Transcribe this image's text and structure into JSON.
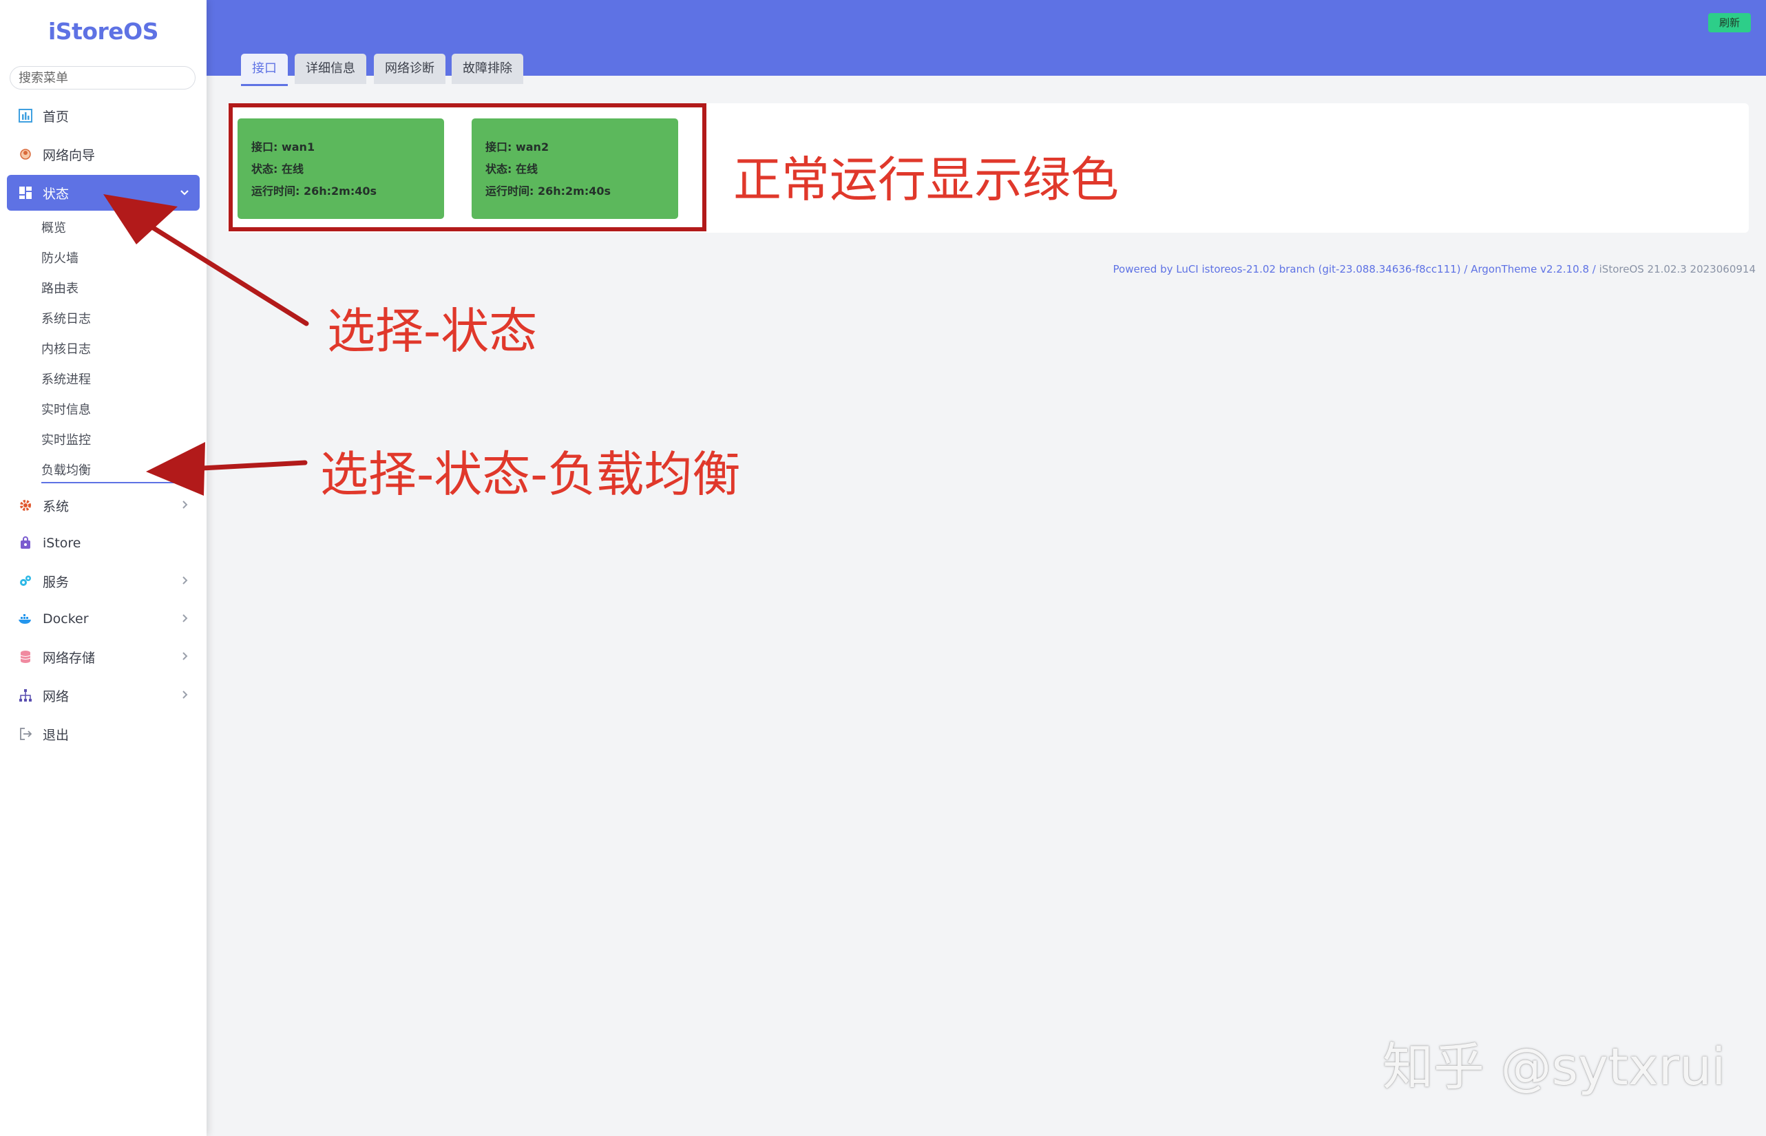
{
  "app": {
    "logo": "iStoreOS"
  },
  "sidebar": {
    "search_placeholder": "搜索菜单",
    "items": [
      {
        "label": "首页",
        "icon": "chart-bar-icon"
      },
      {
        "label": "网络向导",
        "icon": "globe-pin-icon"
      },
      {
        "label": "状态",
        "icon": "dashboard-grid-icon",
        "expanded": true
      },
      {
        "label": "系统",
        "icon": "gear-icon"
      },
      {
        "label": "iStore",
        "icon": "store-icon"
      },
      {
        "label": "服务",
        "icon": "gears-icon"
      },
      {
        "label": "Docker",
        "icon": "docker-whale-icon"
      },
      {
        "label": "网络存储",
        "icon": "database-icon"
      },
      {
        "label": "网络",
        "icon": "network-tree-icon"
      },
      {
        "label": "退出",
        "icon": "logout-icon"
      }
    ],
    "status_subitems": [
      "概览",
      "防火墙",
      "路由表",
      "系统日志",
      "内核日志",
      "系统进程",
      "实时信息",
      "实时监控",
      "负载均衡"
    ]
  },
  "header": {
    "refresh_label": "刷新"
  },
  "tabs": [
    "接口",
    "详细信息",
    "网络诊断",
    "故障排除"
  ],
  "interfaces": [
    {
      "name": "接口: wan1",
      "status": "状态: 在线",
      "uptime": "运行时间: 26h:2m:40s"
    },
    {
      "name": "接口: wan2",
      "status": "状态: 在线",
      "uptime": "运行时间: 26h:2m:40s"
    }
  ],
  "footer": {
    "powered": "Powered by LuCI istoreos-21.02 branch (git-23.088.34636-f8cc111) / ArgonTheme v2.2.10.8 /",
    "version": "iStoreOS 21.02.3 2023060914"
  },
  "annotations": {
    "green_note": "正常运行显示绿色",
    "select_status": "选择-状态",
    "select_loadbalance": "选择-状态-负载均衡"
  },
  "watermark": "知乎 @sytxrui",
  "colors": {
    "accent": "#5e72e4",
    "online_green": "#5cb85c",
    "annotation_red": "#e0382b",
    "refresh_green": "#2dce89"
  }
}
